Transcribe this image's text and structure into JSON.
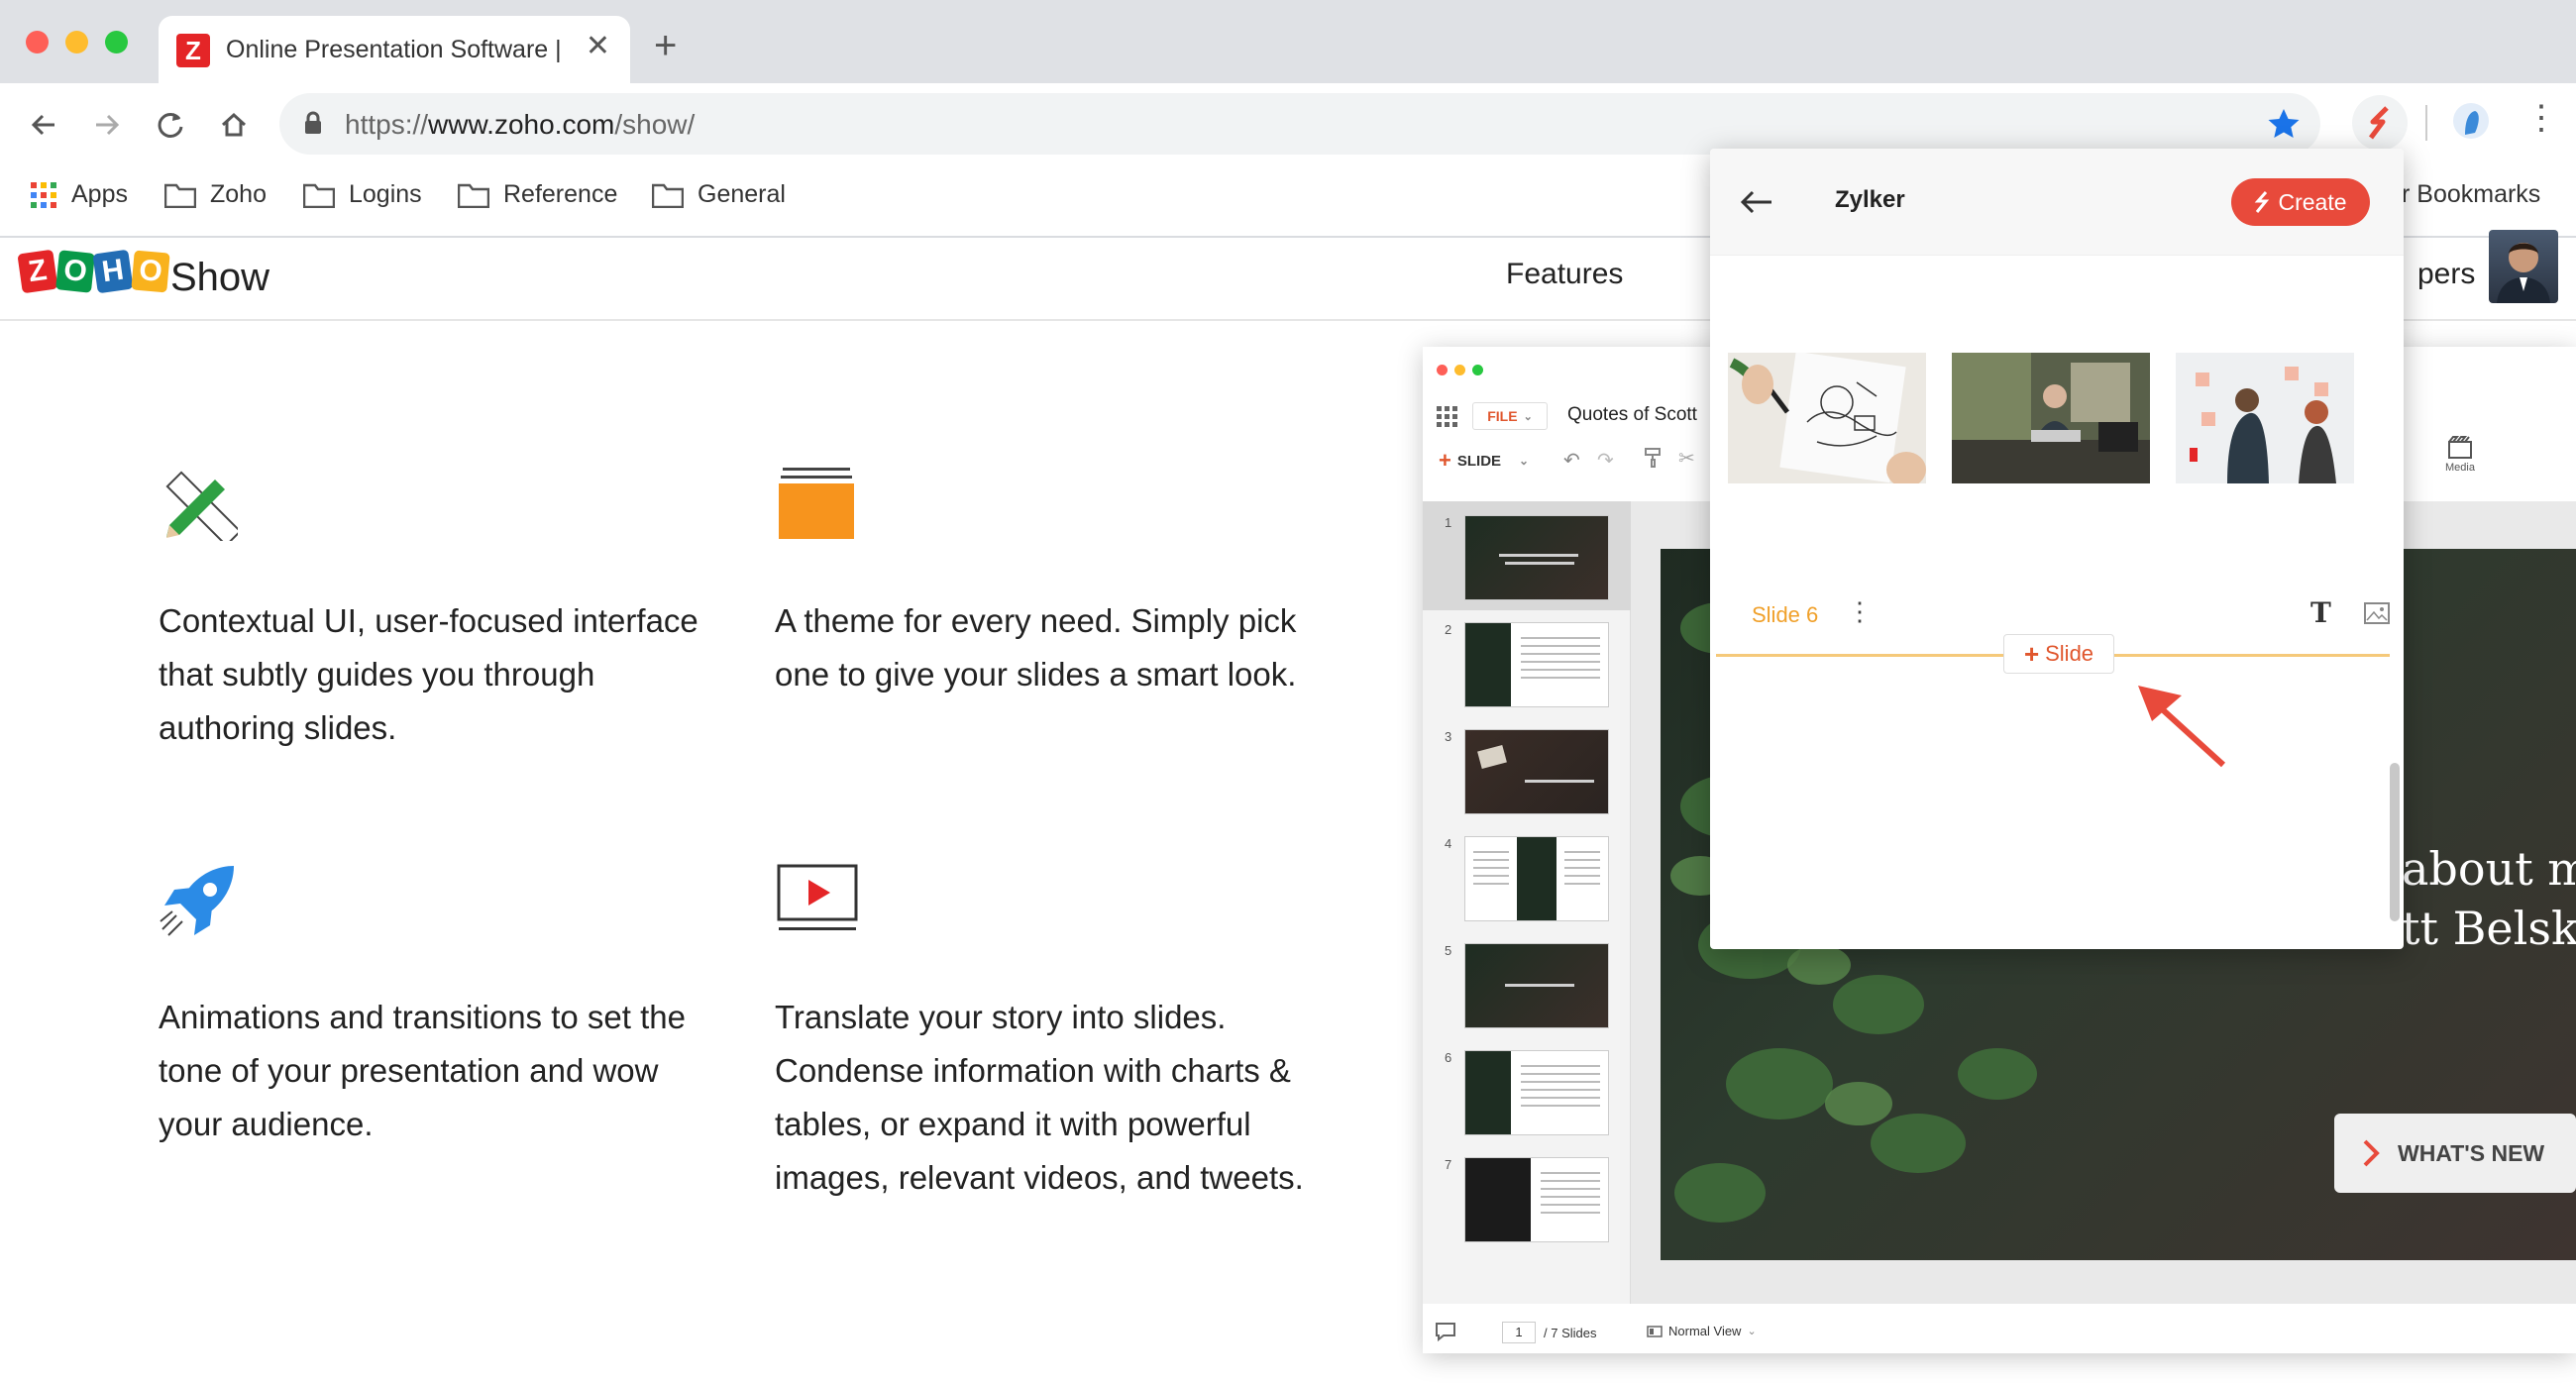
{
  "browser": {
    "tab_title": "Online Presentation Software |",
    "tab_favicon": "Z",
    "url_scheme": "https://",
    "url_host": "www.zoho.com",
    "url_path": "/show/",
    "bookmarks": [
      "Apps",
      "Zoho",
      "Logins",
      "Reference",
      "General"
    ],
    "other_bookmarks": "r Bookmarks"
  },
  "site": {
    "logo_letters": [
      "Z",
      "O",
      "H",
      "O"
    ],
    "brand": "Show",
    "nav_features": "Features",
    "nav_partial": "pers"
  },
  "features": [
    {
      "icon": "pencil-ruler-icon",
      "text": "Contextual UI, user-focused interface that subtly guides you through authoring slides."
    },
    {
      "icon": "theme-folder-icon",
      "text": "A theme for every need. Simply pick one to give your slides a smart look."
    },
    {
      "icon": "rocket-icon",
      "text": "Animations and transitions to set the tone of your presentation and wow your audience."
    },
    {
      "icon": "play-screen-icon",
      "text": "Translate your story into slides. Condense information with charts & tables, or expand it with powerful images, relevant videos, and tweets."
    }
  ],
  "app": {
    "file_label": "FILE",
    "doc_title": "Quotes of Scott",
    "slide_label": "SLIDE",
    "media_label": "Media",
    "slide_numbers": [
      "1",
      "2",
      "3",
      "4",
      "5",
      "6",
      "7"
    ],
    "page_current": "1",
    "page_total": "/ 7 Slides",
    "view_mode": "Normal View",
    "slide_text_1": "about mo",
    "slide_text_2": "tt Belsky"
  },
  "overlay": {
    "title": "Zylker",
    "create_label": "Create",
    "slide_name": "Slide 6",
    "add_slide_label": "Slide"
  },
  "whats_new": "WHAT'S NEW",
  "colors": {
    "zoho_red": "#e42527",
    "zoho_green": "#089949",
    "zoho_blue": "#226db4",
    "zoho_yellow": "#f9b21d",
    "accent_orange": "#e84a3b",
    "slide_label_orange": "#f0a02a"
  }
}
